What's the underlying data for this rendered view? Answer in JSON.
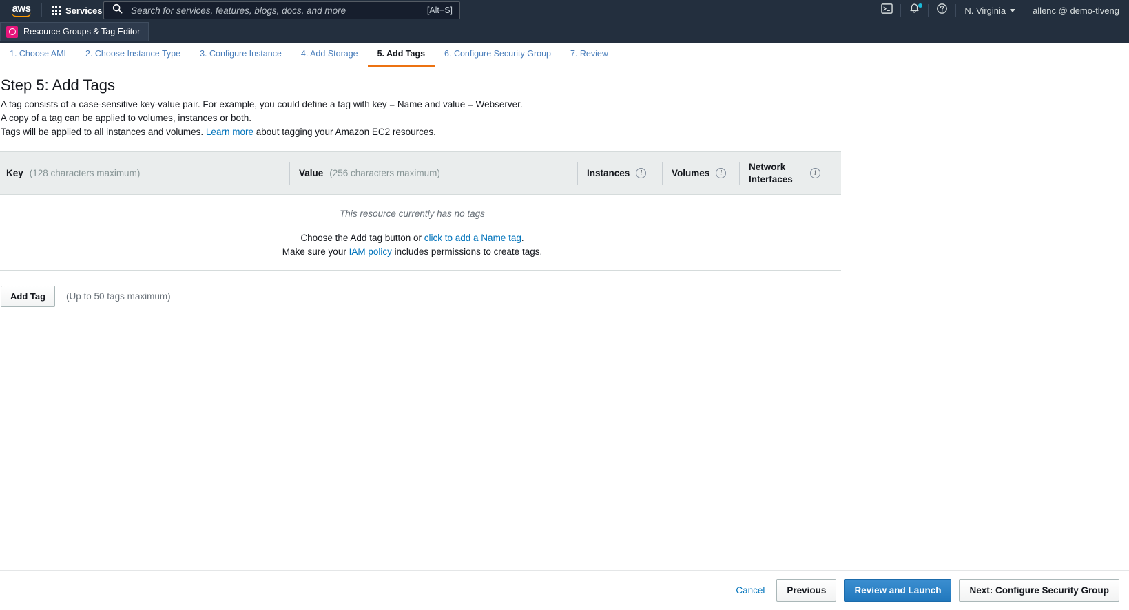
{
  "topbar": {
    "logo_text": "aws",
    "services_label": "Services",
    "services_icon": "grid-apps-icon",
    "search_placeholder": "Search for services, features, blogs, docs, and more",
    "search_value": "",
    "search_icon": "search-icon",
    "search_shortcut": "[Alt+S]",
    "cloudshell_icon": "terminal-icon",
    "notifications_icon": "bell-icon",
    "help_icon": "question-circle-icon",
    "region_label": "N. Virginia",
    "account_label": "allenc @ demo-tlveng"
  },
  "secondbar": {
    "pinned_service": "Resource Groups & Tag Editor",
    "pinned_service_icon": "resource-groups-icon"
  },
  "wizard": {
    "steps": [
      {
        "label": "1. Choose AMI",
        "active": false
      },
      {
        "label": "2. Choose Instance Type",
        "active": false
      },
      {
        "label": "3. Configure Instance",
        "active": false
      },
      {
        "label": "4. Add Storage",
        "active": false
      },
      {
        "label": "5. Add Tags",
        "active": true
      },
      {
        "label": "6. Configure Security Group",
        "active": false
      },
      {
        "label": "7. Review",
        "active": false
      }
    ]
  },
  "page": {
    "title": "Step 5: Add Tags",
    "desc_line1": "A tag consists of a case-sensitive key-value pair. For example, you could define a tag with key = Name and value = Webserver.",
    "desc_line2": "A copy of a tag can be applied to volumes, instances or both.",
    "desc_line3_prefix": "Tags will be applied to all instances and volumes. ",
    "desc_line3_link": "Learn more",
    "desc_line3_suffix": " about tagging your Amazon EC2 resources."
  },
  "table": {
    "columns": {
      "key_label": "Key",
      "key_hint": "(128 characters maximum)",
      "value_label": "Value",
      "value_hint": "(256 characters maximum)",
      "instances_label": "Instances",
      "volumes_label": "Volumes",
      "network_interfaces_label": "Network Interfaces"
    },
    "empty_note": "This resource currently has no tags",
    "empty_help_line1_prefix": "Choose the Add tag button or ",
    "empty_help_line1_link": "click to add a Name tag",
    "empty_help_line1_suffix": ".",
    "empty_help_line2_prefix": "Make sure your ",
    "empty_help_line2_link": "IAM policy",
    "empty_help_line2_suffix": " includes permissions to create tags.",
    "rows": []
  },
  "actions": {
    "add_tag_label": "Add Tag",
    "max_tags_note": "(Up to 50 tags maximum)",
    "cancel_label": "Cancel",
    "previous_label": "Previous",
    "review_launch_label": "Review and Launch",
    "next_label": "Next: Configure Security Group"
  },
  "colors": {
    "nav_background": "#232f3e",
    "active_step_underline": "#ec7211",
    "link": "#0073bb",
    "primary_button": "#2178bd",
    "service_badge": "#e7157b",
    "table_header": "#eaeded"
  }
}
